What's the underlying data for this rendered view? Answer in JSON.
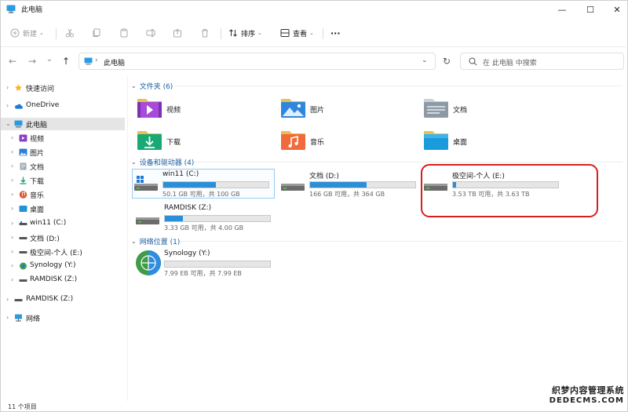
{
  "window": {
    "title": "此电脑",
    "minimize_glyph": "—",
    "maximize_glyph": "☐",
    "close_glyph": "✕"
  },
  "toolbar": {
    "new_label": "新建",
    "sort_label": "排序",
    "view_label": "查看",
    "more_glyph": "···"
  },
  "address_bar": {
    "back_glyph": "←",
    "forward_glyph": "→",
    "recent_glyph": "⌄",
    "up_glyph": "↑",
    "breadcrumb": "此电脑",
    "refresh_glyph": "↻",
    "search_placeholder": "在 此电脑 中搜索"
  },
  "nav_pane": {
    "items": [
      {
        "label": "快速访问",
        "icon": "star-icon"
      },
      {
        "label": "OneDrive",
        "icon": "cloud-icon"
      },
      {
        "label": "此电脑",
        "icon": "pc-icon"
      },
      {
        "label": "视频",
        "icon": "video-icon"
      },
      {
        "label": "图片",
        "icon": "pictures-icon"
      },
      {
        "label": "文档",
        "icon": "documents-icon"
      },
      {
        "label": "下载",
        "icon": "download-icon"
      },
      {
        "label": "音乐",
        "icon": "music-icon"
      },
      {
        "label": "桌面",
        "icon": "desktop-icon"
      },
      {
        "label": "win11 (C:)",
        "icon": "drive-icon"
      },
      {
        "label": "文档 (D:)",
        "icon": "drive-icon"
      },
      {
        "label": "极空间-个人 (E:)",
        "icon": "drive-icon"
      },
      {
        "label": "Synology (Y:)",
        "icon": "network-drive-icon"
      },
      {
        "label": "RAMDISK (Z:)",
        "icon": "drive-icon"
      },
      {
        "label": "RAMDISK (Z:)",
        "icon": "drive-icon"
      },
      {
        "label": "网络",
        "icon": "network-icon"
      }
    ]
  },
  "content": {
    "folders_header": "文件夹 (6)",
    "folders": [
      {
        "label": "视频",
        "icon": "video-folder-icon"
      },
      {
        "label": "图片",
        "icon": "pictures-folder-icon"
      },
      {
        "label": "文档",
        "icon": "documents-folder-icon"
      },
      {
        "label": "下载",
        "icon": "download-folder-icon"
      },
      {
        "label": "音乐",
        "icon": "music-folder-icon"
      },
      {
        "label": "桌面",
        "icon": "desktop-folder-icon"
      }
    ],
    "drives_header": "设备和驱动器 (4)",
    "drives": [
      {
        "name": "win11 (C:)",
        "info": "50.1 GB 可用，共 100 GB",
        "used_fraction": 0.5
      },
      {
        "name": "文档 (D:)",
        "info": "166 GB 可用，共 364 GB",
        "used_fraction": 0.54
      },
      {
        "name": "极空间-个人 (E:)",
        "info": "3.53 TB 可用，共 3.63 TB",
        "used_fraction": 0.03
      },
      {
        "name": "RAMDISK (Z:)",
        "info": "3.33 GB 可用，共 4.00 GB",
        "used_fraction": 0.17
      }
    ],
    "network_header": "网络位置 (1)",
    "network": [
      {
        "name": "Synology (Y:)",
        "info": "7.99 EB 可用，共 7.99 EB",
        "used_fraction": 0.0
      }
    ]
  },
  "status_bar": {
    "count": "11 个项目"
  },
  "watermark": {
    "line1": "织梦内容管理系统",
    "line2": "DEDECMS.COM"
  },
  "colors": {
    "accent": "#2b8fd8",
    "highlight_ring": "#d81e1e",
    "section_header": "#1a5fa0"
  }
}
